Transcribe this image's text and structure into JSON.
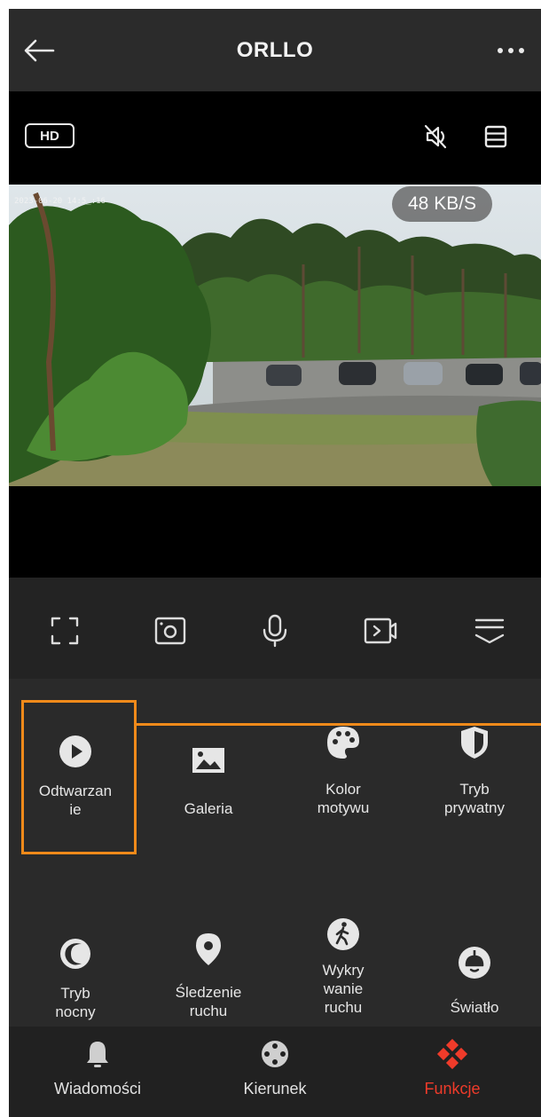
{
  "header": {
    "title": "ORLLO",
    "back_icon": "arrow-left-icon",
    "more_icon": "more-horizontal-icon"
  },
  "player": {
    "quality_label": "HD",
    "timestamp": "2023-06-20 14:5_:16",
    "bitrate": "48 KB/S",
    "mute_icon": "speaker-muted-icon",
    "layout_icon": "split-view-icon"
  },
  "controls": [
    {
      "name": "fullscreen",
      "icon": "fullscreen-icon"
    },
    {
      "name": "screenshot",
      "icon": "camera-snapshot-icon"
    },
    {
      "name": "talk",
      "icon": "microphone-icon"
    },
    {
      "name": "record",
      "icon": "video-record-icon"
    },
    {
      "name": "more",
      "icon": "chevron-menu-icon"
    }
  ],
  "functions": {
    "playback": "Odtwarzan\nie",
    "gallery": "Galeria",
    "theme_color": "Kolor\nmotywu",
    "privacy_mode": "Tryb\nprywatny",
    "night_mode": "Tryb\nnocny",
    "motion_tracking": "Śledzenie\nruchu",
    "motion_detection": "Wykry\nwanie\nruchu",
    "light": "Światło"
  },
  "nav": {
    "messages": "Wiadomości",
    "direction": "Kierunek",
    "functions": "Funkcje"
  },
  "colors": {
    "accent": "#ef3b2a",
    "highlight": "#f08a1a",
    "background": "#262626"
  }
}
